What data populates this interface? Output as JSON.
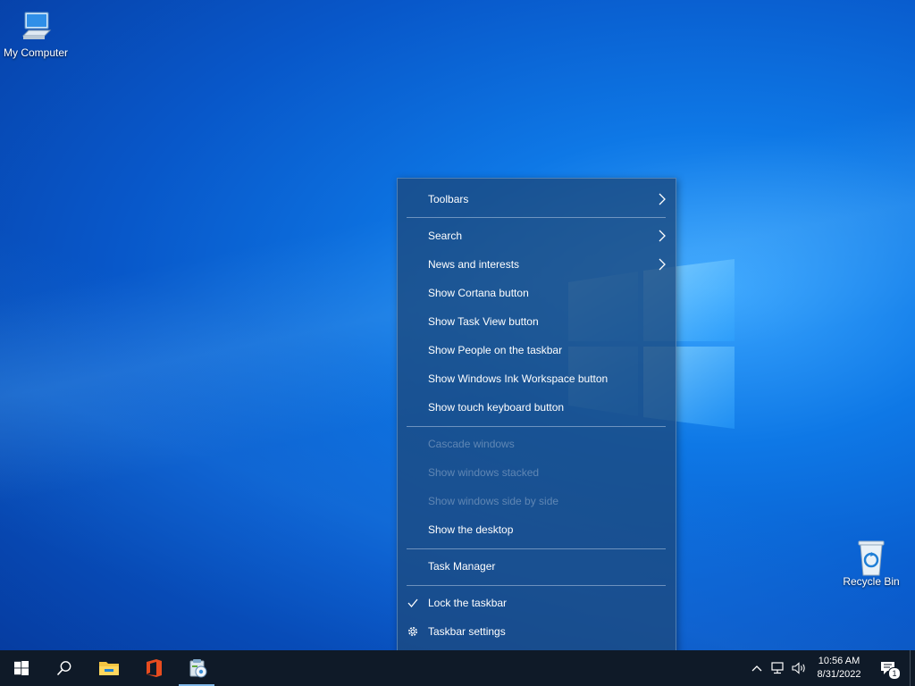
{
  "desktop": {
    "icons": [
      {
        "label": "My Computer",
        "icon": "computer-icon"
      },
      {
        "label": "Recycle Bin",
        "icon": "recycle-bin-icon"
      }
    ]
  },
  "context_menu": {
    "items": [
      {
        "label": "Toolbars",
        "submenu": true,
        "enabled": true
      },
      {
        "label": "Search",
        "submenu": true,
        "enabled": true
      },
      {
        "label": "News and interests",
        "submenu": true,
        "enabled": true
      },
      {
        "label": "Show Cortana button",
        "enabled": true
      },
      {
        "label": "Show Task View button",
        "enabled": true
      },
      {
        "label": "Show People on the taskbar",
        "enabled": true
      },
      {
        "label": "Show Windows Ink Workspace button",
        "enabled": true
      },
      {
        "label": "Show touch keyboard button",
        "enabled": true
      },
      {
        "label": "Cascade windows",
        "enabled": false
      },
      {
        "label": "Show windows stacked",
        "enabled": false
      },
      {
        "label": "Show windows side by side",
        "enabled": false
      },
      {
        "label": "Show the desktop",
        "enabled": true
      },
      {
        "label": "Task Manager",
        "enabled": true
      },
      {
        "label": "Lock the taskbar",
        "checked": true,
        "enabled": true
      },
      {
        "label": "Taskbar settings",
        "icon": "gear-icon",
        "enabled": true
      }
    ]
  },
  "taskbar": {
    "buttons": [
      {
        "name": "start-button",
        "icon": "windows-logo-icon"
      },
      {
        "name": "search-button",
        "icon": "search-icon"
      },
      {
        "name": "file-explorer-button",
        "icon": "folder-icon"
      },
      {
        "name": "office-button",
        "icon": "office-icon"
      },
      {
        "name": "app-button",
        "icon": "setup-icon"
      }
    ],
    "tray": {
      "time": "10:56 AM",
      "date": "8/31/2022",
      "notification_count": "1"
    }
  },
  "colors": {
    "menu_bg": "#1c4a80",
    "taskbar_bg": "#0f1a28",
    "accent": "#7fb7e8"
  }
}
